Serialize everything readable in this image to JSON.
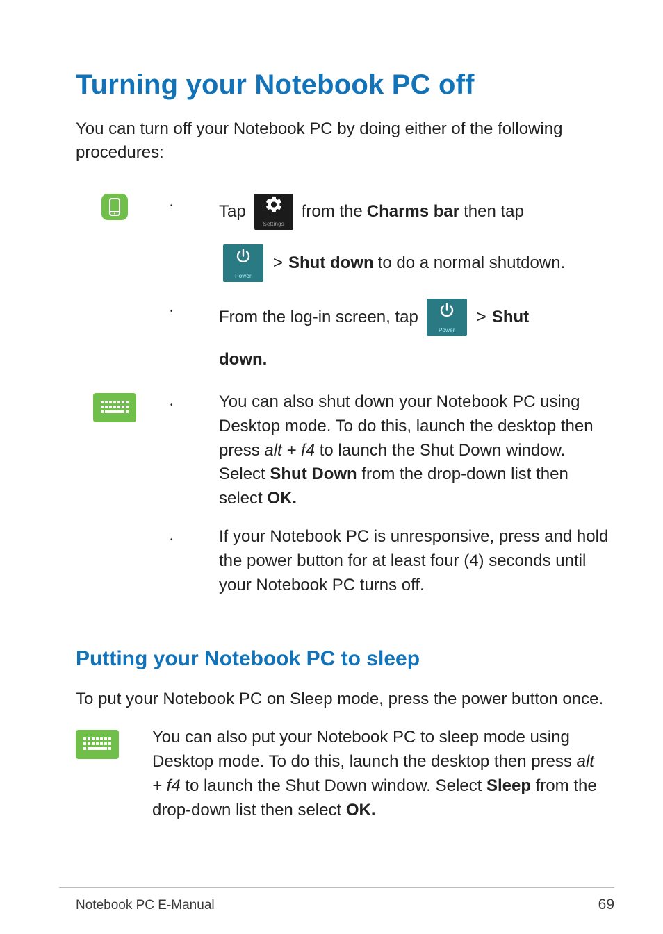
{
  "title": "Turning your Notebook PC off",
  "intro": "You can turn off your Notebook PC by doing either of the following procedures:",
  "icons": {
    "settings_label": "Settings",
    "power_label": "Power"
  },
  "touch_steps": {
    "step1": {
      "pre_tap": "Tap",
      "post_tap": "from  the",
      "charms_bar": "Charms bar",
      "then_tap": "then tap",
      "gt": ">",
      "shut_down": "Shut down",
      "trail": "to do a normal shutdown."
    },
    "step2": {
      "pre": "From the log-in screen, tap",
      "gt": ">",
      "shut": "Shut",
      "down_period": "down."
    }
  },
  "kbd_steps": {
    "step1": {
      "text_a": "You can also shut down your Notebook PC using Desktop mode. To do this, launch the desktop then press ",
      "altf4": "alt + f4",
      "text_b": " to launch the Shut Down window. Select ",
      "shut_down": "Shut Down",
      "text_c": " from the drop-down list then select ",
      "ok": "OK."
    },
    "step2": "If your Notebook PC is unresponsive, press and hold the power button for at least four (4) seconds until your Notebook PC turns off."
  },
  "h2": "Putting your Notebook PC to sleep",
  "sleep_intro": "To put your Notebook PC on Sleep mode, press the power button once.",
  "sleep_body": {
    "a": "You can also put your Notebook PC to sleep mode using Desktop mode. To do this, launch the desktop then press ",
    "altf4": "alt + f4",
    "b": " to launch the Shut Down window. Select ",
    "sleep": "Sleep",
    "c": " from the drop-down list then select ",
    "ok": "OK."
  },
  "footer": "Notebook PC E-Manual",
  "page_number": "69"
}
